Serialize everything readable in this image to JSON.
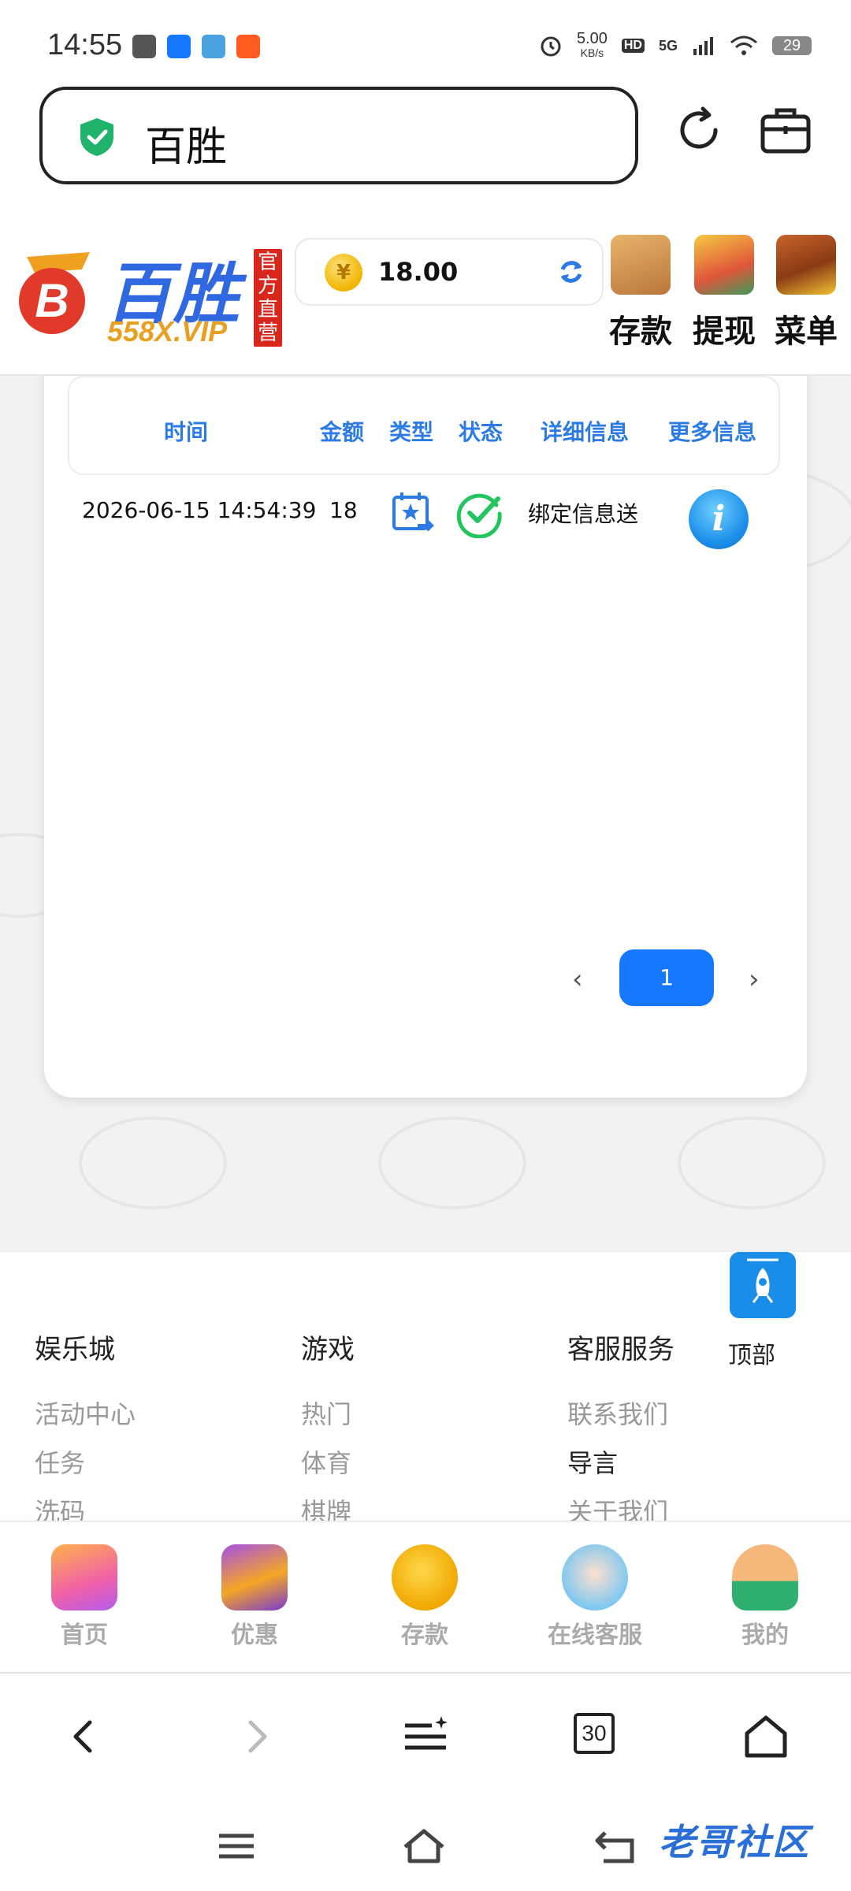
{
  "status_bar": {
    "time": "14:55",
    "net_speed": "5.00",
    "net_speed_unit": "KB/s",
    "hd": "HD",
    "network": "5G",
    "battery": "29"
  },
  "address_bar": {
    "url_text": "百胜"
  },
  "site_header": {
    "logo_name": "百胜",
    "logo_site": "558X.VIP",
    "official_badge": "官方直营",
    "balance": "18.00",
    "coin_symbol": "¥",
    "actions": [
      {
        "label": "存款",
        "icon": "wallet-icon"
      },
      {
        "label": "提现",
        "icon": "withdraw-icon"
      },
      {
        "label": "菜单",
        "icon": "treasure-chest-icon"
      }
    ]
  },
  "records_table": {
    "headers": [
      "时间",
      "金额",
      "类型",
      "状态",
      "详细信息",
      "更多信息"
    ],
    "rows": [
      {
        "time": "2026-06-15 14:54:39",
        "amount": "18",
        "type_icon": "calendar-star-icon",
        "status_icon": "check-circle-icon",
        "detail": "绑定信息送",
        "more_icon": "info-icon",
        "more_symbol": "i"
      }
    ]
  },
  "pagination": {
    "prev": "‹",
    "current": "1",
    "next": "›"
  },
  "back_to_top": {
    "label": "顶部"
  },
  "footer": {
    "columns": [
      {
        "heading": "娱乐城",
        "items": [
          "活动中心",
          "任务",
          "洗码"
        ]
      },
      {
        "heading": "游戏",
        "items": [
          "热门",
          "体育",
          "棋牌"
        ]
      },
      {
        "heading": "客服服务",
        "items": [
          "联系我们",
          "导言",
          "关于我们"
        ]
      }
    ]
  },
  "site_nav": {
    "items": [
      {
        "label": "首页",
        "icon": "home-icon"
      },
      {
        "label": "优惠",
        "icon": "gift-icon"
      },
      {
        "label": "存款",
        "icon": "coin-deposit-icon"
      },
      {
        "label": "在线客服",
        "icon": "headset-support-icon"
      },
      {
        "label": "我的",
        "icon": "user-avatar-icon"
      }
    ]
  },
  "browser_toolbar": {
    "tab_count": "30"
  },
  "system_nav": {
    "watermark": "老哥社区"
  },
  "colors": {
    "accent_blue": "#2c7be5",
    "page_button": "#1677ff",
    "brand_red": "#d9261c",
    "check_green": "#22c55e"
  }
}
